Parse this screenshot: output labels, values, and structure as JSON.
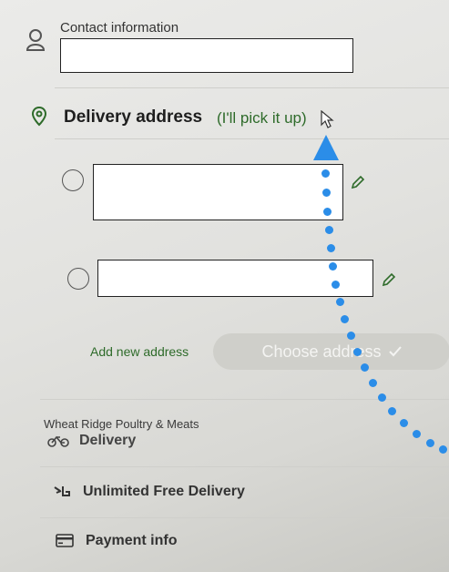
{
  "contact": {
    "label": "Contact information"
  },
  "delivery_address": {
    "title": "Delivery address",
    "pickup_link": "(I'll pick it up)"
  },
  "address_actions": {
    "add_new": "Add new address",
    "choose_button": "Choose address"
  },
  "store": {
    "name": "Wheat Ridge Poultry & Meats",
    "delivery_label": "Delivery"
  },
  "unlimited_free_delivery": {
    "label": "Unlimited Free Delivery"
  },
  "payment": {
    "label": "Payment info"
  },
  "colors": {
    "accent_green": "#2e6b2a",
    "annotation_blue": "#2b8de8"
  },
  "icons": [
    "person-icon",
    "location-pin-icon",
    "pencil-icon",
    "bicycle-icon",
    "delivery-badge-icon",
    "card-icon",
    "cursor-icon",
    "check-icon"
  ]
}
